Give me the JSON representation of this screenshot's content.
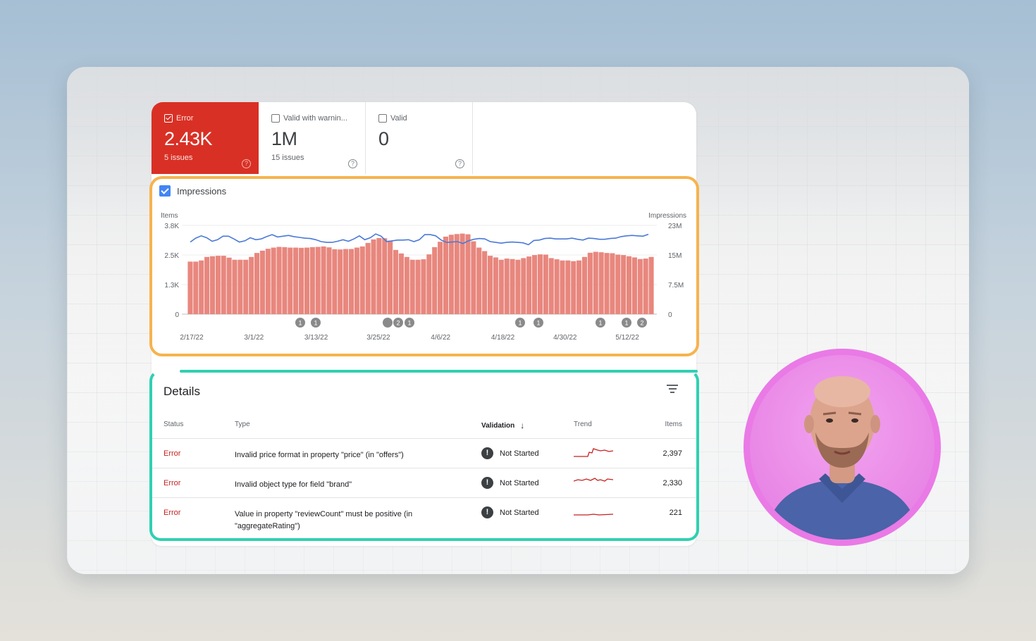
{
  "tiles": [
    {
      "label": "Error",
      "value": "2.43K",
      "sub": "5 issues",
      "checked": true
    },
    {
      "label": "Valid with warnin...",
      "value": "1M",
      "sub": "15 issues",
      "checked": false
    },
    {
      "label": "Valid",
      "value": "0",
      "sub": "",
      "checked": false
    }
  ],
  "impressions_label": "Impressions",
  "chart_data": {
    "type": "bar",
    "left_axis_label": "Items",
    "right_axis_label": "Impressions",
    "left_ticks": [
      "3.8K",
      "2.5K",
      "1.3K",
      "0"
    ],
    "right_ticks": [
      "23M",
      "15M",
      "7.5M",
      "0"
    ],
    "ylim_items": [
      0,
      3800
    ],
    "ylim_impressions": [
      0,
      23000000
    ],
    "x_labels": [
      "2/17/22",
      "3/1/22",
      "3/13/22",
      "3/25/22",
      "4/6/22",
      "4/18/22",
      "4/30/22",
      "5/12/22"
    ],
    "series": [
      {
        "name": "Items",
        "type": "bar",
        "color": "#e8877e",
        "values": [
          2250,
          2250,
          2300,
          2450,
          2480,
          2500,
          2500,
          2420,
          2330,
          2330,
          2330,
          2450,
          2620,
          2720,
          2800,
          2850,
          2880,
          2870,
          2850,
          2850,
          2840,
          2850,
          2870,
          2880,
          2900,
          2860,
          2780,
          2770,
          2790,
          2790,
          2850,
          2900,
          3050,
          3200,
          3260,
          3250,
          3150,
          2750,
          2600,
          2450,
          2330,
          2330,
          2350,
          2560,
          2870,
          3100,
          3320,
          3400,
          3430,
          3450,
          3420,
          3120,
          2850,
          2700,
          2500,
          2430,
          2330,
          2380,
          2360,
          2330,
          2400,
          2470,
          2530,
          2560,
          2550,
          2400,
          2350,
          2300,
          2300,
          2270,
          2300,
          2450,
          2630,
          2670,
          2650,
          2620,
          2610,
          2550,
          2530,
          2480,
          2430,
          2360,
          2380,
          2450
        ]
      },
      {
        "name": "Impressions",
        "type": "line",
        "color": "#4a79d8",
        "values": [
          18700,
          19700,
          20300,
          19800,
          18900,
          19300,
          20200,
          20200,
          19500,
          18700,
          19000,
          19800,
          19300,
          19500,
          20100,
          20600,
          20000,
          20200,
          20400,
          20100,
          19900,
          19700,
          19600,
          19300,
          18800,
          18600,
          18600,
          18900,
          19300,
          18900,
          19500,
          20300,
          19300,
          19800,
          20800,
          20200,
          18800,
          19000,
          19200,
          19200,
          19300,
          18800,
          19300,
          20600,
          20600,
          20300,
          19200,
          18600,
          18700,
          18800,
          18300,
          19000,
          19400,
          19600,
          19500,
          18800,
          18600,
          18400,
          18600,
          18700,
          18600,
          18500,
          18000,
          19100,
          19200,
          19600,
          19700,
          19500,
          19500,
          19500,
          19700,
          19400,
          19200,
          19700,
          19600,
          19400,
          19400,
          19600,
          19700,
          20100,
          20300,
          20400,
          20300,
          20200,
          20700
        ]
      }
    ],
    "annotations": [
      "1",
      "1",
      "2",
      "1",
      "1",
      "1",
      "1",
      "1",
      "2"
    ]
  },
  "details": {
    "title": "Details",
    "columns": {
      "status": "Status",
      "type": "Type",
      "validation": "Validation",
      "trend": "Trend",
      "items": "Items"
    },
    "rows": [
      {
        "status": "Error",
        "type": "Invalid price format in property \"price\" (in \"offers\")",
        "validation": "Not Started",
        "items": "2,397"
      },
      {
        "status": "Error",
        "type": "Invalid object type for field \"brand\"",
        "validation": "Not Started",
        "items": "2,330"
      },
      {
        "status": "Error",
        "type": "Value in property \"reviewCount\" must be positive (in \"aggregateRating\")",
        "validation": "Not Started",
        "items": "221"
      }
    ]
  }
}
